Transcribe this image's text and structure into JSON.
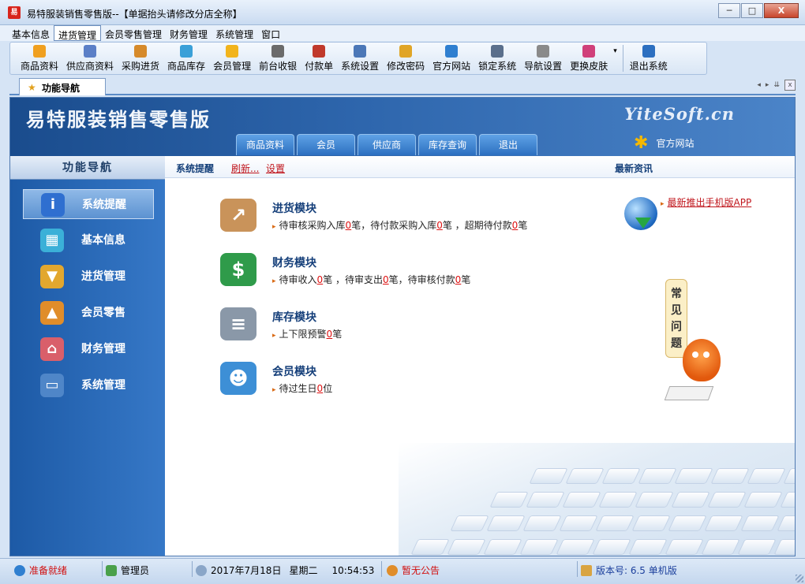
{
  "window": {
    "app_icon_text": "易",
    "title": "易特服装销售零售版--【单据抬头请修改分店全称】",
    "minimize": "─",
    "maximize": "□",
    "close": "X"
  },
  "menubar": {
    "items": [
      {
        "label": "基本信息"
      },
      {
        "label": "进货管理",
        "active": true
      },
      {
        "label": "会员零售管理"
      },
      {
        "label": "财务管理"
      },
      {
        "label": "系统管理"
      },
      {
        "label": "窗口"
      }
    ]
  },
  "toolbar": {
    "items": [
      {
        "label": "商品资料",
        "icon": "goods-icon",
        "color": "#f0a020"
      },
      {
        "label": "供应商资料",
        "icon": "supplier-icon",
        "color": "#5b7fc7"
      },
      {
        "label": "采购进货",
        "icon": "truck-icon",
        "color": "#d68a2a"
      },
      {
        "label": "商品库存",
        "icon": "stock-icon",
        "color": "#3aa0d8"
      },
      {
        "label": "会员管理",
        "icon": "member-icon",
        "color": "#f2b41c"
      },
      {
        "label": "前台收银",
        "icon": "cashier-icon",
        "color": "#6b6b6b"
      },
      {
        "label": "付款单",
        "icon": "payment-icon",
        "color": "#c0392b"
      },
      {
        "label": "系统设置",
        "icon": "settings-icon",
        "color": "#4b77b7"
      },
      {
        "label": "修改密码",
        "icon": "key-icon",
        "color": "#e0a526"
      },
      {
        "label": "官方网站",
        "icon": "ie-icon",
        "color": "#2f7fd0"
      },
      {
        "label": "锁定系统",
        "icon": "lock-icon",
        "color": "#5a6f8c"
      },
      {
        "label": "导航设置",
        "icon": "nav-icon",
        "color": "#8a8a8a"
      },
      {
        "label": "更换皮肤",
        "icon": "skin-icon",
        "color": "#d0407a"
      }
    ],
    "more": "▾",
    "exit": {
      "label": "退出系统",
      "icon": "exit-icon",
      "color": "#2c6fc0"
    }
  },
  "tabbar": {
    "tab_label": "功能导航",
    "ctrl_prev": "◂",
    "ctrl_next": "▸",
    "ctrl_menu": "⇊",
    "ctrl_close": "x"
  },
  "banner": {
    "title": "易特服装销售零售版",
    "site_logo": "YiteSoft.cn",
    "tabs": [
      "商品资料",
      "会员",
      "供应商",
      "库存查询",
      "退出"
    ],
    "site_link": "官方网站"
  },
  "leftnav": {
    "title": "功能导航",
    "items": [
      {
        "label": "系统提醒",
        "icon": "info-icon",
        "color": "#2f6fd0",
        "glyph": "i",
        "active": true
      },
      {
        "label": "基本信息",
        "icon": "cubes-icon",
        "color": "#3bb0d8",
        "glyph": "▦"
      },
      {
        "label": "进货管理",
        "icon": "box-in-icon",
        "color": "#e2a72e",
        "glyph": "▼"
      },
      {
        "label": "会员零售",
        "icon": "box-out-icon",
        "color": "#e08d2a",
        "glyph": "▲"
      },
      {
        "label": "财务管理",
        "icon": "house-money-icon",
        "color": "#d95f6a",
        "glyph": "⌂"
      },
      {
        "label": "系统管理",
        "icon": "monitor-icon",
        "color": "#4f86c8",
        "glyph": "▭"
      }
    ]
  },
  "content": {
    "header": {
      "reminder": "系统提醒",
      "refresh": "刷新...",
      "settings": "设置",
      "news_title": "最新资讯"
    },
    "modules": [
      {
        "title": "进货模块",
        "icon": "purchase-box-icon",
        "color": "#c9935a",
        "glyph": "↗",
        "desc": [
          {
            "t": "待审核采购入库"
          },
          {
            "n": "0"
          },
          {
            "t": "笔，待付款采购入库"
          },
          {
            "n": "0"
          },
          {
            "t": "笔 ，超期待付款"
          },
          {
            "n": "0"
          },
          {
            "t": "笔"
          }
        ]
      },
      {
        "title": "财务模块",
        "icon": "finance-dollar-icon",
        "color": "#2f9b4a",
        "glyph": "$",
        "desc": [
          {
            "t": "待审收入"
          },
          {
            "n": "0"
          },
          {
            "t": "笔 ，待审支出"
          },
          {
            "n": "0"
          },
          {
            "t": "笔，待审核付款"
          },
          {
            "n": "0"
          },
          {
            "t": "笔"
          }
        ]
      },
      {
        "title": "库存模块",
        "icon": "inventory-db-icon",
        "color": "#8a98a8",
        "glyph": "≡",
        "desc": [
          {
            "t": "上下限预警"
          },
          {
            "n": "0"
          },
          {
            "t": "笔"
          }
        ]
      },
      {
        "title": "会员模块",
        "icon": "member-chat-icon",
        "color": "#3d8fd6",
        "glyph": "☻",
        "desc": [
          {
            "t": "待过生日"
          },
          {
            "n": "0"
          },
          {
            "t": "位"
          }
        ]
      }
    ],
    "news": {
      "icon": "globe-download-icon",
      "item": "最新推出手机版APP"
    },
    "faq": {
      "label": "常见问题",
      "chars": [
        "常",
        "见",
        "问",
        "题"
      ]
    }
  },
  "statusbar": {
    "ready": "准备就绪",
    "user": "管理员",
    "date": "2017年7月18日",
    "weekday": "星期二",
    "time": "10:54:53",
    "notice": "暂无公告",
    "version": "版本号: 6.5 单机版"
  }
}
